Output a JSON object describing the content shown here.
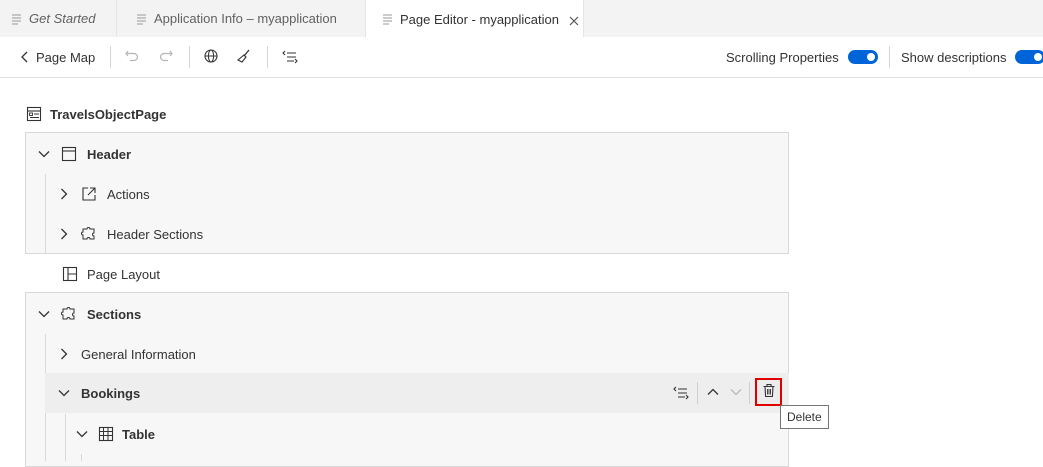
{
  "tabs": [
    {
      "label": "Get Started"
    },
    {
      "label": "Application Info – myapplication"
    },
    {
      "label": "Page Editor - myapplication"
    }
  ],
  "toolbar": {
    "back_label": "Page Map",
    "scrolling_label": "Scrolling Properties",
    "descriptions_label": "Show descriptions"
  },
  "tree": {
    "root": "TravelsObjectPage",
    "header": "Header",
    "actions": "Actions",
    "header_sections": "Header Sections",
    "page_layout": "Page Layout",
    "sections": "Sections",
    "general_information": "General Information",
    "bookings": "Bookings",
    "table": "Table"
  },
  "tooltip": {
    "delete": "Delete"
  },
  "colors": {
    "accent": "#0064d9",
    "highlight_border": "#e00000"
  }
}
